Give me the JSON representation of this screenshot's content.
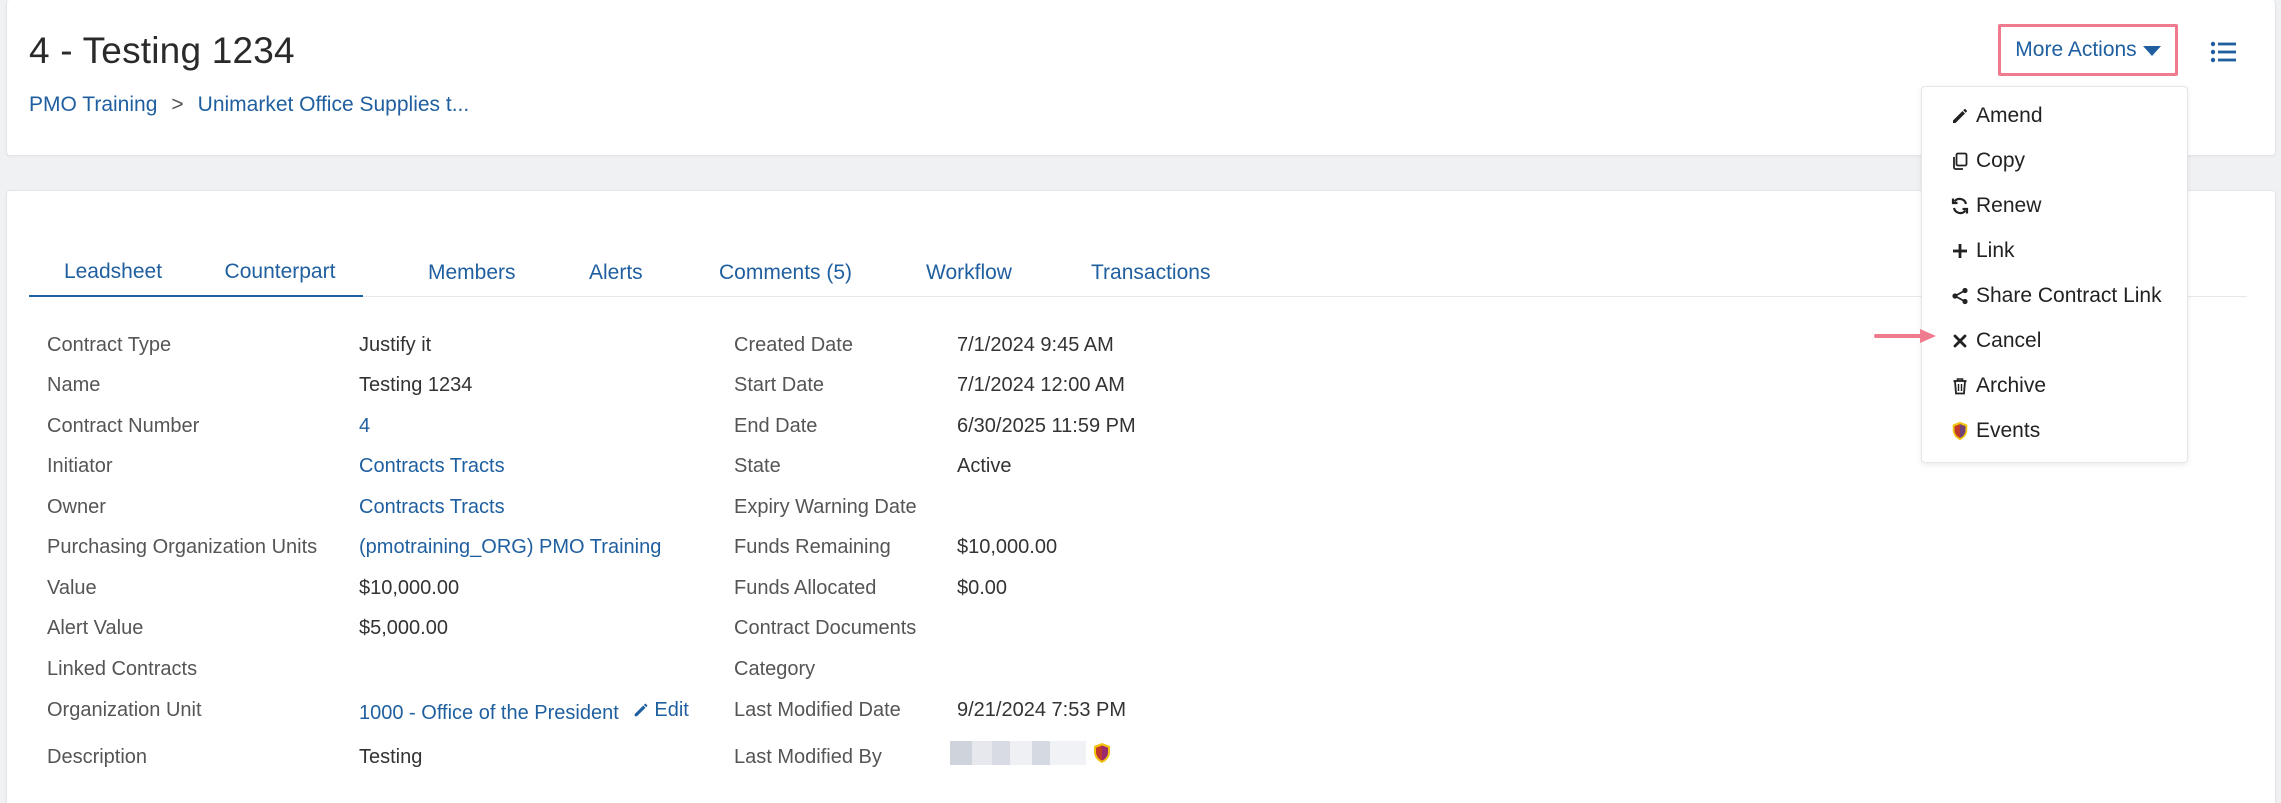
{
  "header": {
    "title": "4 - Testing 1234",
    "breadcrumb": [
      "PMO Training",
      "Unimarket Office Supplies t..."
    ],
    "breadcrumb_separator": ">",
    "more_actions_label": "More Actions"
  },
  "more_actions_menu": [
    {
      "label": "Amend",
      "icon": "pencil-icon"
    },
    {
      "label": "Copy",
      "icon": "copy-icon"
    },
    {
      "label": "Renew",
      "icon": "refresh-icon"
    },
    {
      "label": "Link",
      "icon": "plus-icon"
    },
    {
      "label": "Share Contract Link",
      "icon": "share-icon"
    },
    {
      "label": "Cancel",
      "icon": "close-icon"
    },
    {
      "label": "Archive",
      "icon": "trash-icon"
    },
    {
      "label": "Events",
      "icon": "shield-icon"
    }
  ],
  "tabs": [
    "Leadsheet",
    "Counterpart",
    "Members",
    "Alerts",
    "Comments (5)",
    "Workflow",
    "Transactions"
  ],
  "active_tab": "Leadsheet",
  "details_left": [
    {
      "label": "Contract Type",
      "value": "Justify it"
    },
    {
      "label": "Name",
      "value": "Testing 1234"
    },
    {
      "label": "Contract Number",
      "value": "4"
    },
    {
      "label": "Initiator",
      "value": "Contracts Tracts"
    },
    {
      "label": "Owner",
      "value": "Contracts Tracts"
    },
    {
      "label": "Purchasing Organization Units",
      "value": "(pmotraining_ORG) PMO Training"
    },
    {
      "label": "Value",
      "value": "$10,000.00"
    },
    {
      "label": "Alert Value",
      "value": "$5,000.00"
    },
    {
      "label": "Linked Contracts",
      "value": ""
    },
    {
      "label": "Organization Unit",
      "value": "1000 - Office of the President",
      "action": "Edit"
    },
    {
      "label": "Description",
      "value": "Testing"
    }
  ],
  "details_right": [
    {
      "label": "Created Date",
      "value": "7/1/2024 9:45 AM"
    },
    {
      "label": "Start Date",
      "value": "7/1/2024 12:00 AM"
    },
    {
      "label": "End Date",
      "value": "6/30/2025 11:59 PM"
    },
    {
      "label": "State",
      "value": "Active"
    },
    {
      "label": "Expiry Warning Date",
      "value": ""
    },
    {
      "label": "Funds Remaining",
      "value": "$10,000.00"
    },
    {
      "label": "Funds Allocated",
      "value": "$0.00"
    },
    {
      "label": "Contract Documents",
      "value": ""
    },
    {
      "label": "Category",
      "value": ""
    },
    {
      "label": "Last Modified Date",
      "value": "9/21/2024 7:53 PM"
    },
    {
      "label": "Last Modified By",
      "value": ""
    }
  ],
  "colors": {
    "link": "#1f5f9f",
    "highlight": "#f07a8e",
    "shield_red": "#c0392b",
    "shield_yellow": "#f1c40f"
  }
}
